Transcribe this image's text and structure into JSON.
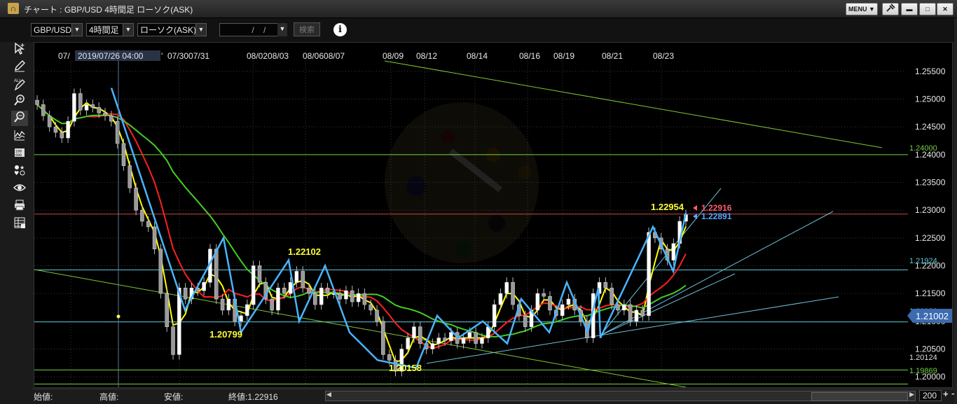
{
  "window": {
    "app_icon": "∩",
    "title": "チャート : GBP/USD 4時間足 ローソク(ASK)",
    "buttons": {
      "menu": "MENU ▼",
      "pin": "pin-icon",
      "minimize": "▬",
      "maximize": "□",
      "close": "✕"
    }
  },
  "toolbar": {
    "pair": "GBP/USD",
    "timeframe": "4時間足",
    "chart_type": "ローソク(ASK)",
    "date_value": "    /    /",
    "search_label": "検索",
    "info_label": "i"
  },
  "left_tools": [
    "pointer-icon",
    "pen-icon",
    "all-delete-icon",
    "zoom-in-icon",
    "zoom-out-icon",
    "indicator-icon",
    "price-board-icon",
    "symbols-icon",
    "eye-icon",
    "print-icon",
    "settings-grid-icon"
  ],
  "colors": {
    "background": "#000000",
    "grid": "#3a3a3a",
    "candle_up": "#ffffff",
    "candle_down": "#999999",
    "ma_fast": "#ffff00",
    "ma_mid": "#ff2020",
    "ma_slow": "#44cc22",
    "zigzag": "#4ab4ff",
    "trend_green": "#7fc832",
    "trend_cyan": "#6fbfd8",
    "level_green": "#72d040",
    "level_cyan": "#5cc8d8",
    "level_red": "#cc4444",
    "price_label_blue": "#3c6bb0",
    "peak_label": "#ffff33",
    "last_ask": "#ff5b6e",
    "last_bid": "#56a8ff"
  },
  "chart": {
    "crosshair_label": "2019/07/26 04:00",
    "x_labels": [
      "07/",
      "07/3007/31",
      "08/0208/03",
      "08/0608/07",
      "08/09",
      "08/12",
      "08/14",
      "08/16",
      "08/19",
      "08/21",
      "08/23"
    ],
    "x_label_tail": "'",
    "y_labels": [
      "1.25500",
      "1.25000",
      "1.24500",
      "1.24000",
      "1.23500",
      "1.23000",
      "1.22500",
      "1.22000",
      "1.21500",
      "1.21000",
      "1.20500",
      "1.20000"
    ],
    "level_labels": {
      "l124": "1.24000",
      "l12192": "1.21924",
      "l12099": "1.20989",
      "l12012": "1.20124",
      "l11987": "1.19869"
    },
    "current_price": "1.21002",
    "peak_labels": [
      "1.22954",
      "1.22102",
      "1.20799",
      "1.20158"
    ],
    "last_ask": "1.22916",
    "last_bid": "1.22891"
  },
  "chart_data": {
    "type": "candlestick",
    "title": "GBP/USD 4時間足 ローソク(ASK)",
    "x_ticks": [
      "07/",
      "07/30",
      "07/31",
      "08/02",
      "08/03",
      "08/06",
      "08/07",
      "08/09",
      "08/12",
      "08/14",
      "08/16",
      "08/19",
      "08/21",
      "08/23"
    ],
    "ylim": [
      1.1975,
      1.2575
    ],
    "y_ticks": [
      1.255,
      1.25,
      1.245,
      1.24,
      1.235,
      1.23,
      1.225,
      1.22,
      1.215,
      1.21,
      1.205,
      1.2
    ],
    "close": [
      1.249,
      1.247,
      1.245,
      1.244,
      1.243,
      1.246,
      1.251,
      1.248,
      1.249,
      1.2485,
      1.2475,
      1.247,
      1.246,
      1.242,
      1.238,
      1.234,
      1.23,
      1.228,
      1.227,
      1.223,
      1.215,
      1.209,
      1.204,
      1.216,
      1.214,
      1.216,
      1.2155,
      1.217,
      1.223,
      1.214,
      1.212,
      1.214,
      1.21,
      1.211,
      1.213,
      1.22,
      1.217,
      1.214,
      1.212,
      1.216,
      1.215,
      1.217,
      1.219,
      1.216,
      1.215,
      1.213,
      1.216,
      1.215,
      1.215,
      1.214,
      1.2155,
      1.2135,
      1.215,
      1.213,
      1.212,
      1.21,
      1.204,
      1.203,
      1.201,
      1.205,
      1.207,
      1.209,
      1.206,
      1.205,
      1.206,
      1.207,
      1.2065,
      1.208,
      1.206,
      1.207,
      1.208,
      1.206,
      1.207,
      1.209,
      1.213,
      1.215,
      1.217,
      1.213,
      1.211,
      1.209,
      1.212,
      1.215,
      1.2145,
      1.212,
      1.211,
      1.213,
      1.214,
      1.212,
      1.21,
      1.207,
      1.215,
      1.217,
      1.216,
      1.213,
      1.212,
      1.213,
      1.21,
      1.212,
      1.211,
      1.226,
      1.225,
      1.223,
      1.221,
      1.224,
      1.228,
      1.2292
    ],
    "levels": {
      "1.24000": "green",
      "1.21924": "cyan",
      "1.20989": "cyan",
      "1.20124": "green",
      "1.19869": "green"
    },
    "zigzag": [
      1.252,
      1.212,
      1.225,
      1.208,
      1.221,
      1.21,
      1.22,
      1.208,
      1.203,
      1.2016,
      1.211,
      1.207,
      1.21,
      1.206,
      1.214,
      1.208,
      1.217,
      1.208,
      1.216,
      1.207,
      1.227,
      1.219,
      1.2295
    ],
    "annotations": [
      "1.22954",
      "1.22102",
      "1.20799",
      "1.20158"
    ]
  }
}
